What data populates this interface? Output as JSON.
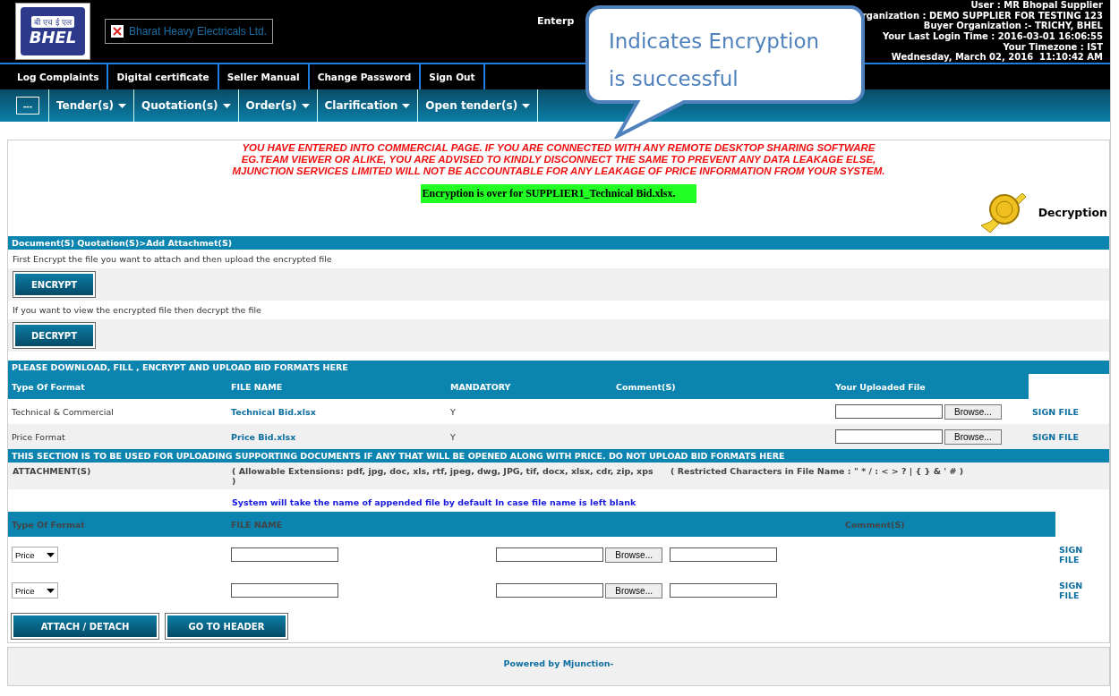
{
  "header": {
    "logo_text": "BHEL",
    "logo_hindi": "बी एच ई एल",
    "broken_image_alt": "Bharat Heavy Electricals Ltd.",
    "center_text": "Enterp",
    "user_info": [
      "User : MR Bhopal Supplier",
      "rganization : DEMO SUPPLIER FOR TESTING 123",
      "Buyer Organization :- TRICHY, BHEL",
      "Your Last Login Time : 2016-03-01 16:06:55",
      "Your Timezone : IST",
      "Wednesday, March 02, 2016  11:10:42 AM"
    ]
  },
  "top_menu": [
    "Log Complaints",
    "Digital certificate",
    "Seller Manual",
    "Change Password",
    "Sign Out"
  ],
  "nav": {
    "collapse_label": "---",
    "items": [
      "Tender(s)",
      "Quotation(s)",
      "Order(s)",
      "Clarification",
      "Open tender(s)"
    ]
  },
  "callout": {
    "text": "Indicates Encryption is successful"
  },
  "warning": [
    "YOU HAVE ENTERED INTO COMMERCIAL PAGE. IF YOU ARE CONNECTED WITH ANY REMOTE DESKTOP SHARING SOFTWARE",
    "EG.TEAM VIEWER OR ALIKE, YOU ARE ADVISED TO KINDLY DISCONNECT THE SAME TO PREVENT ANY DATA LEAKAGE ELSE,",
    "MJUNCTION SERVICES LIMITED WILL NOT BE ACCOUNTABLE FOR ANY LEAKAGE OF PRICE INFORMATION FROM YOUR SYSTEM."
  ],
  "status_message": "Encryption is over for SUPPLIER1_Technical Bid.xlsx.",
  "decryption_label": "Decryption",
  "breadcrumb": "Document(S) Quotation(S)>Add Attachmet(S)",
  "encrypt_hint": "First Encrypt the file you want to attach and then upload the encrypted file",
  "encrypt_button": "ENCRYPT",
  "decrypt_hint": "If you want to view the encrypted file then decrypt the file",
  "decrypt_button": "DECRYPT",
  "bid_formats": {
    "title": "PLEASE DOWNLOAD, FILL , ENCRYPT AND UPLOAD BID FORMATS HERE",
    "columns": [
      "Type Of Format",
      "FILE NAME",
      "MANDATORY",
      "Comment(S)",
      "Your Uploaded File"
    ],
    "rows": [
      {
        "type": "Technical & Commercial",
        "file": "Technical Bid.xlsx",
        "mandatory": "Y",
        "browse": "Browse...",
        "sign": "SIGN FILE"
      },
      {
        "type": "Price Format",
        "file": "Price Bid.xlsx",
        "mandatory": "Y",
        "browse": "Browse...",
        "sign": "SIGN FILE"
      }
    ]
  },
  "supporting": {
    "title": "THIS SECTION IS TO BE USED FOR UPLOADING SUPPORTING DOCUMENTS IF ANY THAT WILL BE OPENED ALONG WITH PRICE. DO NOT UPLOAD BID FORMATS HERE",
    "attachment_label": "ATTACHMENT(S)",
    "extensions": "( Allowable Extensions: pdf, jpg, doc, xls, rtf, jpeg, dwg, JPG, tif, docx, xlsx, cdr, zip, xps )",
    "restricted": "( Restricted Characters in File Name : \" * / : < > ? | { } & ' # )",
    "note": "System will take the name of appended file by default In case file name is left blank",
    "columns": [
      "Type Of Format",
      "FILE NAME",
      "Comment(S)"
    ],
    "rows": [
      {
        "type": "Price",
        "browse": "Browse...",
        "sign": "SIGN FILE"
      },
      {
        "type": "Price",
        "browse": "Browse...",
        "sign": "SIGN FILE"
      }
    ]
  },
  "actions": [
    "ATTACH / DETACH",
    "GO TO HEADER"
  ],
  "footer": {
    "powered_by": "Powered by Mjunction-"
  }
}
